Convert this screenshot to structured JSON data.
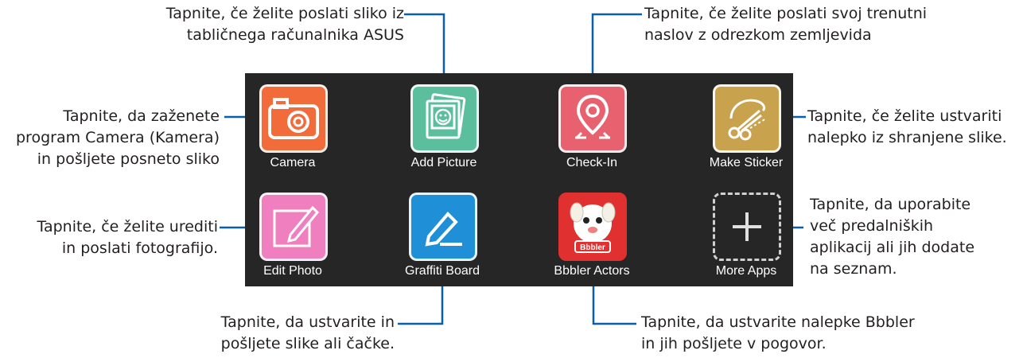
{
  "callouts": {
    "add_picture": [
      "Tapnite, če želite poslati sliko iz",
      "tabličnega računalnika ASUS"
    ],
    "check_in": [
      "Tapnite, če želite poslati svoj trenutni",
      "naslov z odrezkom zemljevida"
    ],
    "camera": [
      "Tapnite, da zaženete",
      "program Camera (Kamera)",
      "in pošljete posneto sliko"
    ],
    "make_sticker": [
      "Tapnite, če želite ustvariti",
      "nalepko iz shranjene slike."
    ],
    "edit_photo": [
      "Tapnite, če želite urediti",
      "in poslati fotografijo."
    ],
    "more_apps": [
      "Tapnite, da uporabite",
      "več predalniških",
      "aplikacij ali jih dodate",
      "na seznam."
    ],
    "graffiti": [
      "Tapnite, da ustvarite in",
      "pošljete slike ali čačke."
    ],
    "bbbler": [
      "Tapnite, da ustvarite nalepke Bbbler",
      "in jih pošljete v pogovor."
    ]
  },
  "apps": {
    "camera": "Camera",
    "add_picture": "Add Picture",
    "check_in": "Check-In",
    "make_sticker": "Make Sticker",
    "edit_photo": "Edit Photo",
    "graffiti_board": "Graffiti Board",
    "bbbler_actors": "Bbbler Actors",
    "more_apps": "More Apps",
    "bbbler_badge": "Bbbler"
  },
  "colors": {
    "line": "#0b5ea8",
    "panel": "#262626",
    "camera": "#f26b3a",
    "add_picture": "#5bbf9e",
    "check_in": "#e8616f",
    "make_sticker": "#c9a24e",
    "edit_photo": "#f07fc0",
    "graffiti_board": "#1f8fd8"
  },
  "icons": {
    "camera": "camera-icon",
    "add_picture": "picture-frame-icon",
    "check_in": "map-pin-icon",
    "make_sticker": "scissors-icon",
    "edit_photo": "pencil-icon",
    "graffiti_board": "pen-underline-icon",
    "bbbler_actors": "cartoon-dog-icon",
    "more_apps": "plus-icon"
  }
}
